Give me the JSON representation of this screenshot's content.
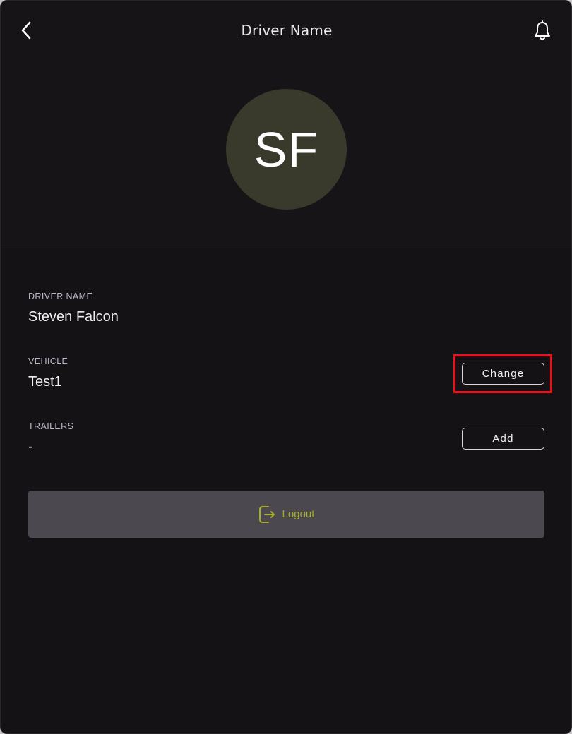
{
  "header": {
    "title": "Driver Name",
    "back_icon": "chevron-left-icon",
    "notification_icon": "bell-icon"
  },
  "profile": {
    "initials": "SF",
    "avatar_color": "#3a3a2c"
  },
  "fields": {
    "driver_name": {
      "label": "DRIVER NAME",
      "value": "Steven Falcon"
    },
    "vehicle": {
      "label": "VEHICLE",
      "value": "Test1",
      "action_label": "Change"
    },
    "trailers": {
      "label": "TRAILERS",
      "value": "-",
      "action_label": "Add"
    }
  },
  "logout": {
    "label": "Logout",
    "icon": "logout-icon",
    "accent_color": "#a6ad2a"
  },
  "colors": {
    "background": "#141214",
    "highlight": "#e8121b"
  }
}
